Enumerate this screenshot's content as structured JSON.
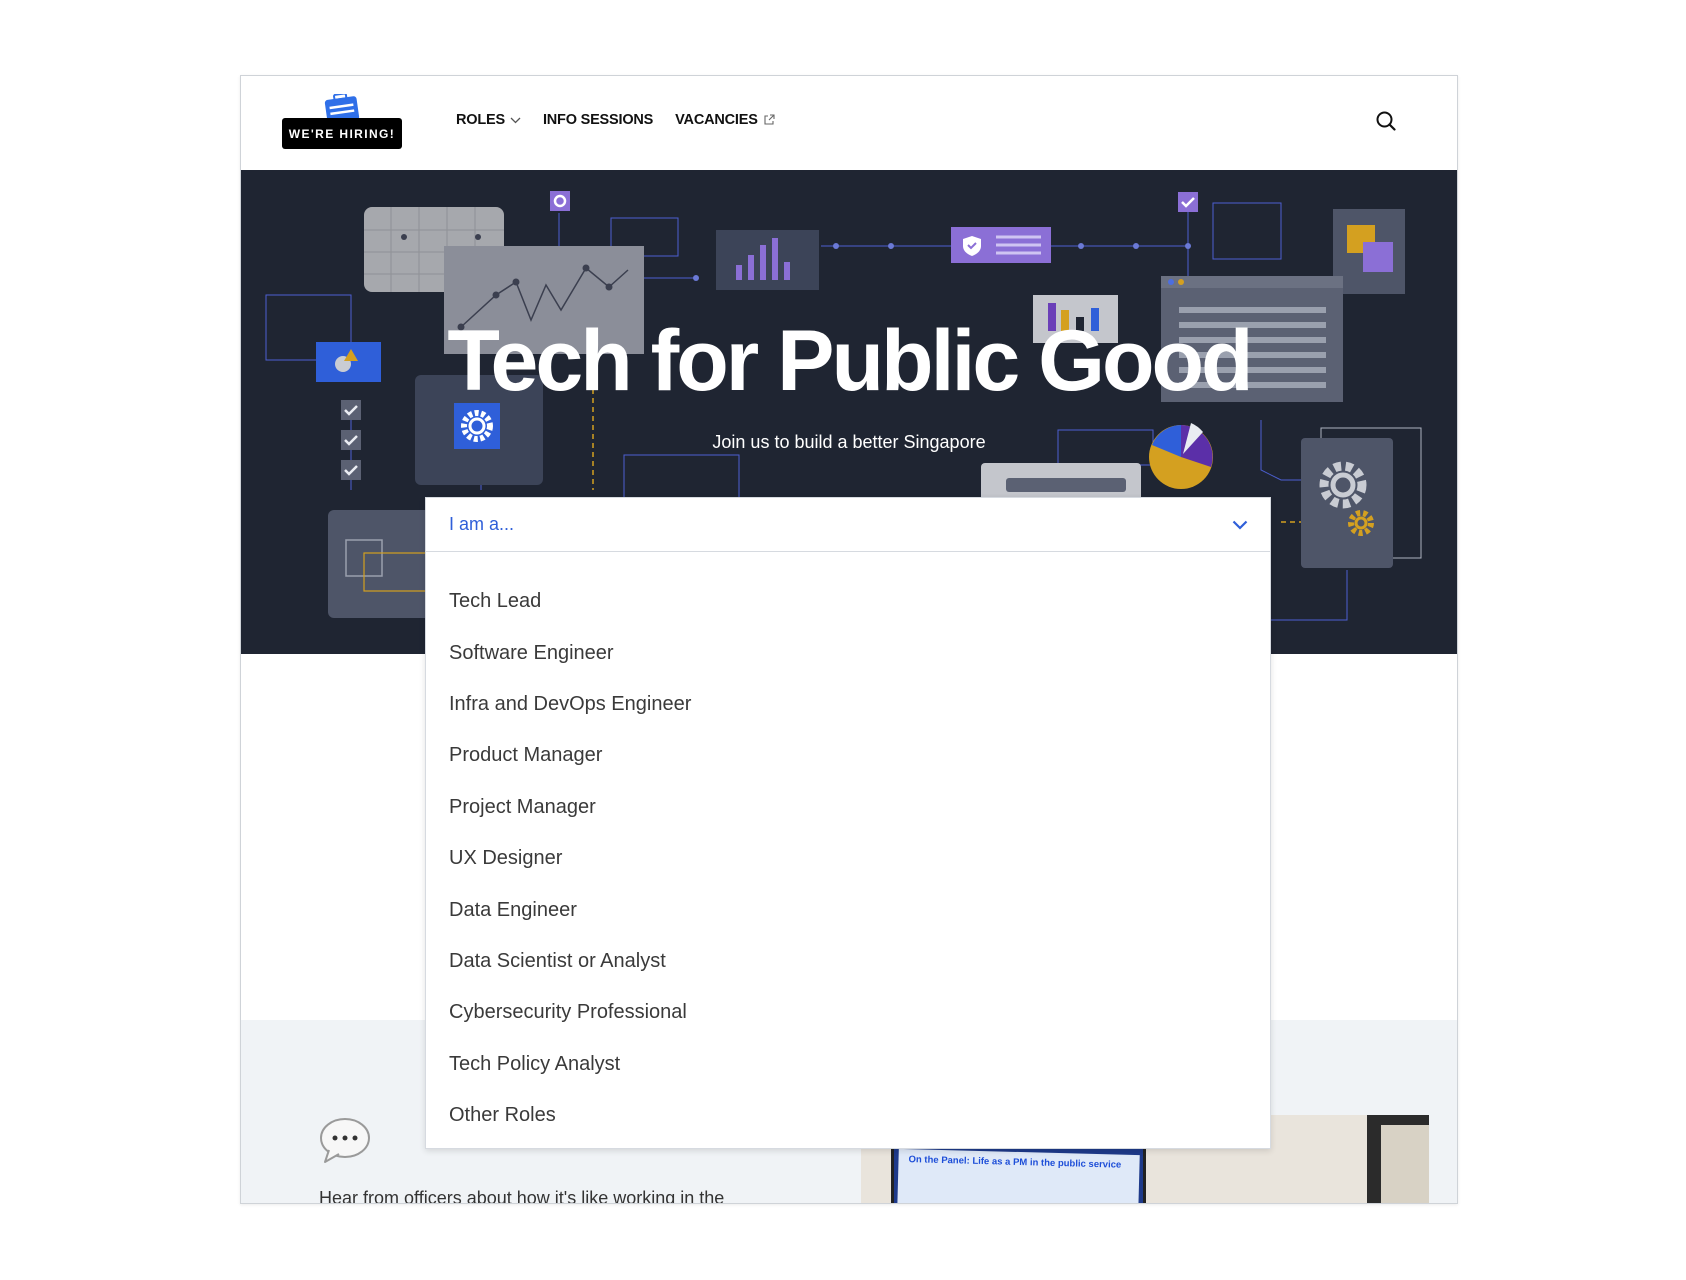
{
  "header": {
    "logo_text": "WE'RE HIRING!",
    "nav": [
      {
        "label": "ROLES",
        "icon": "chevron-down-icon"
      },
      {
        "label": "INFO SESSIONS"
      },
      {
        "label": "VACANCIES",
        "icon": "external-link-icon"
      }
    ],
    "search_icon": "search-icon"
  },
  "hero": {
    "title": "Tech for Public Good",
    "subtitle": "Join us to build a better Singapore"
  },
  "role_select": {
    "placeholder": "I am a...",
    "options": [
      "Tech Lead",
      "Software Engineer",
      "Infra and DevOps Engineer",
      "Product Manager",
      "Project Manager",
      "UX Designer",
      "Data Engineer",
      "Data Scientist or Analyst",
      "Cybersecurity Professional",
      "Tech Policy Analyst",
      "Other Roles"
    ]
  },
  "lower": {
    "intro_text": "Hear from officers about how it's like working in the",
    "photo_caption": "On the Panel: Life as a PM in the public service"
  },
  "colors": {
    "hero_bg": "#1f2532",
    "accent_blue": "#2f5fd9",
    "section_gray": "#f0f3f6",
    "purple": "#8b6fd6",
    "gold": "#d4a020"
  }
}
